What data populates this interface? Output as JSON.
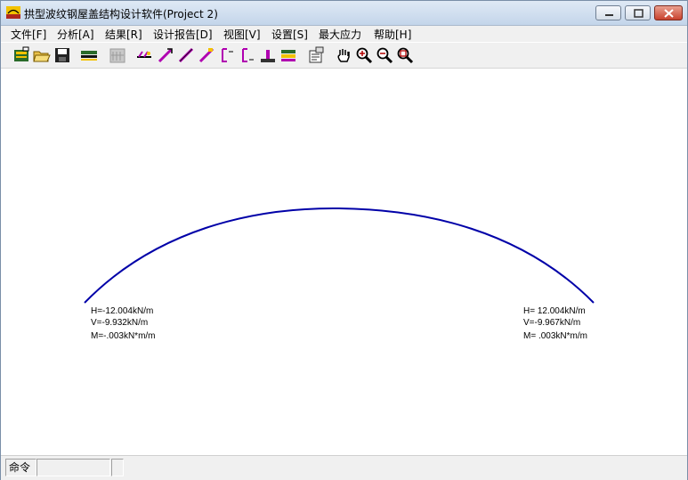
{
  "window": {
    "title": "拱型波纹钢屋盖结构设计软件(Project 2)"
  },
  "menu": [
    {
      "label": "文件[F]"
    },
    {
      "label": "分析[A]"
    },
    {
      "label": "结果[R]"
    },
    {
      "label": "设计报告[D]"
    },
    {
      "label": "视图[V]"
    },
    {
      "label": "设置[S]"
    },
    {
      "label": "最大应力"
    },
    {
      "label": "帮助[H]"
    }
  ],
  "toolbar_icons": [
    "new-project-icon",
    "open-folder-icon",
    "save-icon",
    "section-icon",
    "calculator-icon",
    "support-icon",
    "load-arrow-icon",
    "line-load-icon",
    "distributed-load-icon",
    "bracket-load-icon",
    "bracket-right-icon",
    "column-icon",
    "results-color-icon",
    "properties-icon",
    "pan-hand-icon",
    "zoom-in-icon",
    "zoom-out-icon",
    "zoom-all-icon"
  ],
  "canvas": {
    "arch_color": "#0000a8",
    "left_support": {
      "H": "H=-12.004kN/m",
      "V": "V=-9.932kN/m",
      "M": "M=-.003kN*m/m"
    },
    "right_support": {
      "H": "H= 12.004kN/m",
      "V": "V=-9.967kN/m",
      "M": "M= .003kN*m/m"
    }
  },
  "status": {
    "command_label": "命令",
    "panel2": "",
    "panel3": ""
  }
}
